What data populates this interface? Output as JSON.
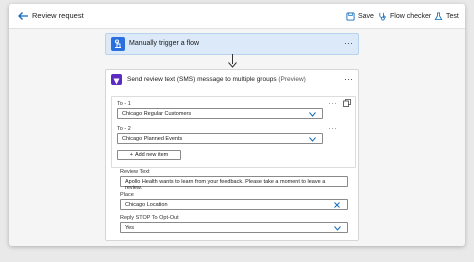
{
  "header": {
    "title": "Review request",
    "save_label": "Save",
    "flow_checker_label": "Flow checker",
    "test_label": "Test"
  },
  "trigger": {
    "label": "Manually trigger a flow",
    "more": "···"
  },
  "action": {
    "title": "Send review text (SMS) message to multiple groups",
    "preview": "(Preview)",
    "more": "···",
    "items": [
      {
        "label": "To - 1",
        "value": "Chicago Regular Customers",
        "more": "···"
      },
      {
        "label": "To - 2",
        "value": "Chicago Planned Events",
        "more": "···"
      }
    ],
    "add_item_label": "Add new item",
    "add_item_symbol": "+",
    "review_text": {
      "label": "Review Text",
      "value": "Apollo Health wants to learn from your feedback. Please take a moment to leave a review."
    },
    "place": {
      "label": "Place",
      "value": "Chicago Location"
    },
    "reply_stop": {
      "label": "Reply STOP To Opt-Out",
      "value": "Yes"
    }
  },
  "colors": {
    "accent": "#0f6cbd",
    "trigger_bg": "#dbe9f8",
    "trigger_icon": "#2a6fe0",
    "action_icon": "#5b2bc2"
  }
}
